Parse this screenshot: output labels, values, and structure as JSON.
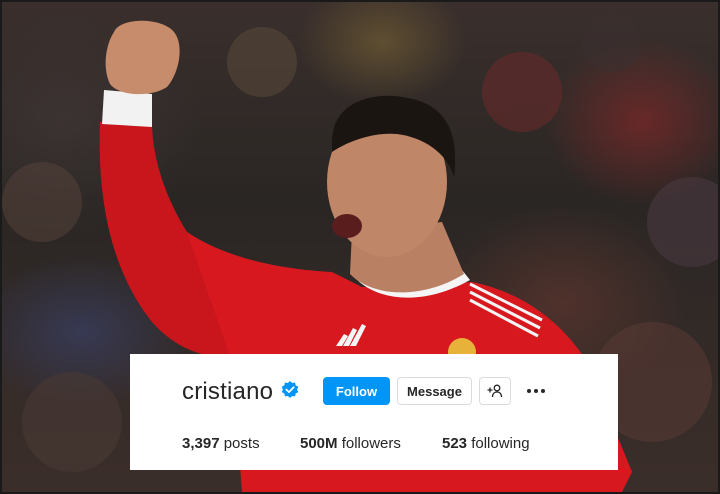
{
  "photo": {
    "description_icon": "athlete-celebration-photo"
  },
  "profile": {
    "username": "cristiano",
    "verified_icon": "verified-badge-icon",
    "follow_label": "Follow",
    "message_label": "Message",
    "suggest_icon": "add-person-icon",
    "more_icon": "more-options-icon",
    "stats": {
      "posts_count": "3,397",
      "posts_label": "posts",
      "followers_count": "500M",
      "followers_label": "followers",
      "following_count": "523",
      "following_label": "following"
    }
  },
  "colors": {
    "accent": "#0095f6",
    "text": "#262626",
    "border": "#dbdbdb",
    "jersey": "#d7191f"
  }
}
